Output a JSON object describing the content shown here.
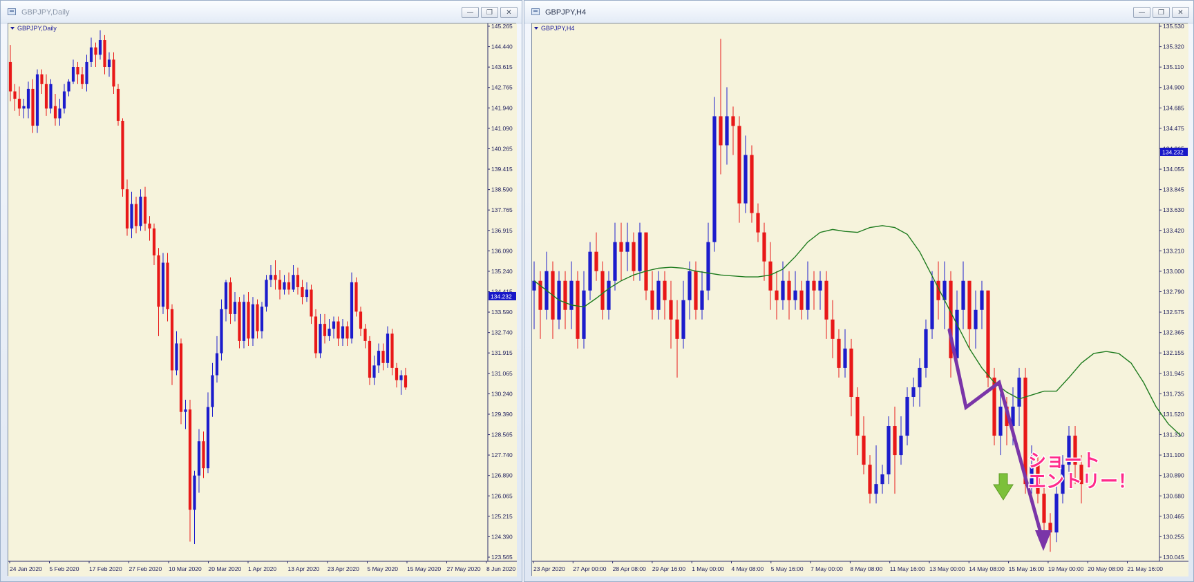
{
  "left": {
    "title": "GBPJPY,Daily",
    "chart_label": "GBPJPY,Daily",
    "price_tag": "134.232",
    "colors": {
      "bg": "#f6f3dc",
      "bull": "#1c1ccc",
      "bear": "#e81818",
      "axis": "#1c1c9c",
      "tag": "#1717c8"
    },
    "chart_data": {
      "type": "candlestick",
      "ylim": [
        123.565,
        145.265
      ],
      "y_ticks": [
        "145.265",
        "144.440",
        "143.615",
        "142.765",
        "141.940",
        "141.090",
        "140.265",
        "139.415",
        "138.590",
        "137.765",
        "136.915",
        "136.090",
        "135.240",
        "134.415",
        "133.590",
        "132.740",
        "131.915",
        "131.065",
        "130.240",
        "129.390",
        "128.565",
        "127.740",
        "126.890",
        "126.065",
        "125.215",
        "124.390",
        "123.565"
      ],
      "x_labels": [
        "24 Jan 2020",
        "5 Feb 2020",
        "17 Feb 2020",
        "27 Feb 2020",
        "10 Mar 2020",
        "20 Mar 2020",
        "1 Apr 2020",
        "13 Apr 2020",
        "23 Apr 2020",
        "5 May 2020",
        "15 May 2020",
        "27 May 2020",
        "8 Jun 2020"
      ],
      "candles": [
        [
          143.8,
          142.6,
          144.5,
          142.2
        ],
        [
          142.6,
          142.3,
          142.9,
          141.8
        ],
        [
          142.3,
          141.9,
          142.8,
          141.6
        ],
        [
          141.9,
          142.0,
          142.3,
          141.5
        ],
        [
          141.9,
          142.7,
          143.0,
          141.5
        ],
        [
          142.7,
          141.2,
          143.1,
          140.9
        ],
        [
          141.2,
          143.3,
          143.5,
          140.9
        ],
        [
          143.3,
          142.9,
          143.5,
          142.5
        ],
        [
          142.9,
          141.9,
          143.3,
          141.6
        ],
        [
          141.9,
          142.9,
          143.1,
          141.7
        ],
        [
          142.0,
          141.5,
          142.5,
          141.2
        ],
        [
          141.5,
          141.9,
          142.3,
          141.2
        ],
        [
          141.9,
          142.6,
          142.9,
          141.7
        ],
        [
          142.6,
          143.0,
          143.1,
          142.4
        ],
        [
          143.0,
          143.6,
          143.9,
          142.9
        ],
        [
          143.6,
          143.3,
          143.8,
          142.9
        ],
        [
          143.3,
          142.9,
          143.6,
          142.7
        ],
        [
          142.9,
          143.8,
          144.1,
          142.6
        ],
        [
          143.8,
          144.4,
          144.8,
          143.6
        ],
        [
          144.4,
          144.1,
          144.6,
          143.6
        ],
        [
          144.1,
          144.7,
          145.1,
          143.9
        ],
        [
          144.7,
          143.6,
          144.9,
          143.3
        ],
        [
          143.6,
          143.9,
          144.2,
          143.2
        ],
        [
          143.9,
          142.8,
          144.2,
          142.5
        ],
        [
          142.7,
          141.4,
          142.9,
          141.2
        ],
        [
          141.4,
          138.6,
          141.5,
          138.3
        ],
        [
          138.6,
          137.0,
          139.0,
          136.7
        ],
        [
          137.0,
          138.0,
          138.5,
          136.6
        ],
        [
          138.0,
          137.1,
          138.3,
          136.8
        ],
        [
          137.1,
          138.3,
          138.6,
          136.9
        ],
        [
          138.3,
          137.2,
          138.7,
          136.9
        ],
        [
          137.2,
          137.0,
          137.5,
          136.5
        ],
        [
          137.0,
          135.9,
          137.2,
          135.5
        ],
        [
          135.9,
          133.8,
          136.2,
          132.6
        ],
        [
          133.8,
          135.6,
          136.0,
          133.5
        ],
        [
          135.6,
          133.7,
          136.0,
          133.2
        ],
        [
          133.7,
          131.2,
          133.9,
          130.6
        ],
        [
          131.2,
          132.3,
          132.8,
          131.0
        ],
        [
          132.3,
          129.5,
          132.5,
          129.0
        ],
        [
          129.5,
          129.6,
          130.0,
          128.8
        ],
        [
          129.6,
          125.5,
          130.0,
          124.2
        ],
        [
          125.5,
          126.9,
          127.1,
          124.1
        ],
        [
          126.9,
          128.3,
          128.8,
          126.2
        ],
        [
          128.3,
          127.2,
          128.7,
          126.8
        ],
        [
          127.2,
          129.7,
          130.3,
          127.0
        ],
        [
          129.7,
          131.0,
          131.5,
          129.3
        ],
        [
          131.0,
          131.9,
          132.6,
          130.7
        ],
        [
          131.9,
          133.7,
          134.1,
          131.6
        ],
        [
          133.7,
          134.8,
          134.9,
          133.2
        ],
        [
          134.8,
          133.5,
          135.0,
          133.1
        ],
        [
          133.5,
          134.0,
          134.4,
          133.2
        ],
        [
          134.0,
          132.4,
          134.2,
          132.1
        ],
        [
          132.4,
          134.0,
          134.3,
          132.1
        ],
        [
          134.0,
          132.5,
          134.4,
          132.2
        ],
        [
          132.5,
          133.9,
          134.2,
          132.2
        ],
        [
          133.9,
          132.8,
          134.1,
          132.5
        ],
        [
          132.8,
          133.8,
          134.0,
          132.5
        ],
        [
          133.8,
          134.9,
          135.1,
          133.6
        ],
        [
          134.9,
          135.1,
          135.5,
          134.6
        ],
        [
          135.1,
          134.9,
          135.7,
          134.5
        ],
        [
          134.9,
          134.5,
          135.3,
          134.1
        ],
        [
          134.5,
          134.8,
          135.1,
          134.3
        ],
        [
          134.8,
          134.5,
          135.2,
          134.3
        ],
        [
          134.5,
          135.1,
          135.5,
          134.4
        ],
        [
          135.1,
          134.6,
          135.4,
          134.3
        ],
        [
          134.6,
          134.2,
          134.9,
          133.9
        ],
        [
          134.2,
          134.5,
          134.8,
          134.0
        ],
        [
          134.5,
          133.4,
          134.7,
          133.1
        ],
        [
          133.4,
          131.9,
          133.7,
          131.7
        ],
        [
          131.9,
          133.1,
          133.5,
          131.7
        ],
        [
          133.1,
          132.6,
          133.5,
          132.3
        ],
        [
          132.6,
          132.9,
          133.3,
          132.4
        ],
        [
          132.9,
          133.2,
          133.4,
          132.5
        ],
        [
          133.2,
          132.5,
          133.4,
          132.2
        ],
        [
          132.5,
          133.0,
          133.3,
          132.2
        ],
        [
          133.0,
          132.5,
          133.2,
          132.2
        ],
        [
          132.5,
          134.8,
          135.2,
          132.3
        ],
        [
          134.8,
          133.6,
          135.0,
          133.4
        ],
        [
          133.6,
          132.9,
          133.8,
          132.6
        ],
        [
          132.9,
          132.4,
          133.1,
          132.1
        ],
        [
          132.4,
          130.9,
          132.6,
          130.6
        ],
        [
          130.9,
          131.4,
          131.8,
          130.6
        ],
        [
          131.4,
          132.0,
          132.3,
          131.1
        ],
        [
          132.0,
          131.5,
          132.3,
          131.2
        ],
        [
          131.5,
          132.7,
          133.0,
          131.3
        ],
        [
          132.7,
          131.3,
          132.9,
          131.0
        ],
        [
          131.3,
          130.8,
          131.5,
          130.5
        ],
        [
          130.8,
          131.0,
          131.2,
          130.2
        ],
        [
          131.0,
          130.5,
          131.3,
          130.4
        ]
      ]
    }
  },
  "right": {
    "title": "GBPJPY,H4",
    "chart_label": "GBPJPY,H4",
    "price_tag": "134.232",
    "annotation": {
      "line1": "ショート",
      "line2": "エントリー！"
    },
    "colors": {
      "bg": "#f6f3dc",
      "bull": "#1c1ccc",
      "bear": "#e81818",
      "ma": "#1e7b1e",
      "arrow": "#7a35a8",
      "annot_fill": "#ff2a8a",
      "down_arrow": "#7cc03a",
      "axis": "#1c1c9c",
      "tag": "#1717c8"
    },
    "chart_data": {
      "type": "candlestick",
      "ylim": [
        130.045,
        135.53
      ],
      "y_ticks": [
        "135.530",
        "135.320",
        "135.110",
        "134.900",
        "134.685",
        "134.475",
        "134.265",
        "134.055",
        "133.845",
        "133.630",
        "133.420",
        "133.210",
        "133.000",
        "132.790",
        "132.575",
        "132.365",
        "132.155",
        "131.945",
        "131.735",
        "131.520",
        "131.310",
        "131.100",
        "130.890",
        "130.680",
        "130.465",
        "130.255",
        "130.045"
      ],
      "x_labels": [
        "23 Apr 2020",
        "27 Apr 00:00",
        "28 Apr 08:00",
        "29 Apr 16:00",
        "1 May 00:00",
        "4 May 08:00",
        "5 May 16:00",
        "7 May 00:00",
        "8 May 08:00",
        "11 May 16:00",
        "13 May 00:00",
        "14 May 08:00",
        "15 May 16:00",
        "19 May 00:00",
        "20 May 08:00",
        "21 May 16:00"
      ],
      "ma": [
        132.9,
        132.8,
        132.7,
        132.65,
        132.63,
        132.72,
        132.82,
        132.9,
        132.96,
        133.0,
        133.03,
        133.04,
        133.03,
        133.0,
        132.98,
        132.96,
        132.95,
        132.94,
        132.94,
        132.96,
        133.02,
        133.15,
        133.3,
        133.4,
        133.43,
        133.41,
        133.4,
        133.45,
        133.47,
        133.45,
        133.38,
        133.2,
        132.95,
        132.7,
        132.45,
        132.2,
        132.0,
        131.85,
        131.75,
        131.68,
        131.72,
        131.76,
        131.76,
        131.9,
        132.05,
        132.15,
        132.17,
        132.15,
        132.05,
        131.85,
        131.6,
        131.42,
        131.3
      ],
      "ma_start": 0,
      "ma_step": 2,
      "candles": [
        [
          132.8,
          132.9,
          133.1,
          132.4
        ],
        [
          132.9,
          132.6,
          133.0,
          132.3
        ],
        [
          132.6,
          133.0,
          133.2,
          132.5
        ],
        [
          133.0,
          132.5,
          133.1,
          132.3
        ],
        [
          132.5,
          132.9,
          133.0,
          132.4
        ],
        [
          132.9,
          132.6,
          133.0,
          132.4
        ],
        [
          132.6,
          132.9,
          133.1,
          132.4
        ],
        [
          132.9,
          132.3,
          133.0,
          132.2
        ],
        [
          132.3,
          132.8,
          133.0,
          132.2
        ],
        [
          132.8,
          133.2,
          133.3,
          132.7
        ],
        [
          133.2,
          133.0,
          133.4,
          132.9
        ],
        [
          133.0,
          132.6,
          133.1,
          132.5
        ],
        [
          132.6,
          132.9,
          133.0,
          132.5
        ],
        [
          132.9,
          133.3,
          133.5,
          132.8
        ],
        [
          133.3,
          133.2,
          133.5,
          132.9
        ],
        [
          133.2,
          133.3,
          133.5,
          133.0
        ],
        [
          133.3,
          133.0,
          133.4,
          132.9
        ],
        [
          133.0,
          133.4,
          133.5,
          132.9
        ],
        [
          133.4,
          132.8,
          133.4,
          132.7
        ],
        [
          132.8,
          132.6,
          133.0,
          132.5
        ],
        [
          132.6,
          132.9,
          133.0,
          132.5
        ],
        [
          132.9,
          132.7,
          133.0,
          132.5
        ],
        [
          132.7,
          132.5,
          132.9,
          132.2
        ],
        [
          132.5,
          132.3,
          132.7,
          131.9
        ],
        [
          132.3,
          132.7,
          132.9,
          132.2
        ],
        [
          132.7,
          133.0,
          133.1,
          132.5
        ],
        [
          133.0,
          132.6,
          133.1,
          132.5
        ],
        [
          132.6,
          132.8,
          133.0,
          132.5
        ],
        [
          132.8,
          133.3,
          133.5,
          132.7
        ],
        [
          133.3,
          134.6,
          134.8,
          133.2
        ],
        [
          134.6,
          134.3,
          135.4,
          134.0
        ],
        [
          134.3,
          134.6,
          134.9,
          134.1
        ],
        [
          134.6,
          134.5,
          134.7,
          134.2
        ],
        [
          134.5,
          133.7,
          134.6,
          133.5
        ],
        [
          133.7,
          134.2,
          134.4,
          133.6
        ],
        [
          134.2,
          133.6,
          134.3,
          133.5
        ],
        [
          133.6,
          133.4,
          133.7,
          133.3
        ],
        [
          133.4,
          133.1,
          133.5,
          132.9
        ],
        [
          133.1,
          132.8,
          133.3,
          132.6
        ],
        [
          132.8,
          132.7,
          133.0,
          132.5
        ],
        [
          132.7,
          132.9,
          133.1,
          132.6
        ],
        [
          132.9,
          132.7,
          133.0,
          132.5
        ],
        [
          132.7,
          132.8,
          133.0,
          132.6
        ],
        [
          132.8,
          132.6,
          132.9,
          132.5
        ],
        [
          132.6,
          132.9,
          133.1,
          132.5
        ],
        [
          132.9,
          132.8,
          133.0,
          132.6
        ],
        [
          132.8,
          132.9,
          133.0,
          132.6
        ],
        [
          132.9,
          132.5,
          133.0,
          132.3
        ],
        [
          132.5,
          132.3,
          132.7,
          132.1
        ],
        [
          132.3,
          132.0,
          132.4,
          131.9
        ],
        [
          132.0,
          132.2,
          132.4,
          131.9
        ],
        [
          132.2,
          131.7,
          132.3,
          131.5
        ],
        [
          131.7,
          131.3,
          131.8,
          131.1
        ],
        [
          131.3,
          131.0,
          131.5,
          130.9
        ],
        [
          131.0,
          130.7,
          131.1,
          130.6
        ],
        [
          130.7,
          130.8,
          131.2,
          130.6
        ],
        [
          130.8,
          130.9,
          131.0,
          130.7
        ],
        [
          130.9,
          131.4,
          131.5,
          130.8
        ],
        [
          131.4,
          131.1,
          131.6,
          130.7
        ],
        [
          131.1,
          131.3,
          131.5,
          131.0
        ],
        [
          131.3,
          131.7,
          131.8,
          131.2
        ],
        [
          131.7,
          131.8,
          131.9,
          131.6
        ],
        [
          131.8,
          132.0,
          132.1,
          131.6
        ],
        [
          132.0,
          132.4,
          132.5,
          131.9
        ],
        [
          132.4,
          132.9,
          133.0,
          132.3
        ],
        [
          132.9,
          132.7,
          133.1,
          132.5
        ],
        [
          132.7,
          132.9,
          133.1,
          132.4
        ],
        [
          132.9,
          132.1,
          133.0,
          131.9
        ],
        [
          132.1,
          132.6,
          132.8,
          132.0
        ],
        [
          132.6,
          132.9,
          133.1,
          132.4
        ],
        [
          132.9,
          132.4,
          132.9,
          132.2
        ],
        [
          132.4,
          132.6,
          132.8,
          132.2
        ],
        [
          132.6,
          132.8,
          132.9,
          132.4
        ],
        [
          132.8,
          131.9,
          132.8,
          131.8
        ],
        [
          131.9,
          131.3,
          132.0,
          131.2
        ],
        [
          131.3,
          131.6,
          131.8,
          131.1
        ],
        [
          131.6,
          131.4,
          131.7,
          131.2
        ],
        [
          131.4,
          131.6,
          131.8,
          131.2
        ],
        [
          131.6,
          131.9,
          132.0,
          131.4
        ],
        [
          131.9,
          130.8,
          132.0,
          130.7
        ],
        [
          130.8,
          131.0,
          131.2,
          130.7
        ],
        [
          131.0,
          130.7,
          131.1,
          130.6
        ],
        [
          130.7,
          130.4,
          130.8,
          130.3
        ],
        [
          130.4,
          130.3,
          130.5,
          130.1
        ],
        [
          130.3,
          130.7,
          130.8,
          130.2
        ],
        [
          130.7,
          131.0,
          131.1,
          130.6
        ],
        [
          131.0,
          131.3,
          131.4,
          130.9
        ],
        [
          131.3,
          131.0,
          131.4,
          130.8
        ],
        [
          131.0,
          130.8,
          131.1,
          130.6
        ]
      ]
    }
  }
}
